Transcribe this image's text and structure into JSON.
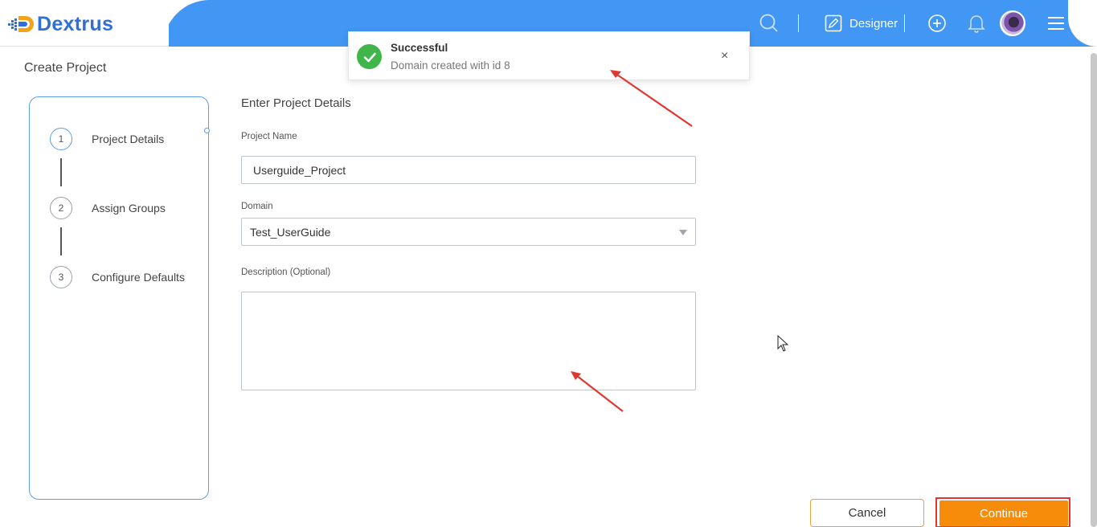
{
  "app": {
    "name": "Dextrus"
  },
  "header": {
    "role_label": "Designer",
    "icons": [
      "search-icon",
      "edit-icon",
      "add-circle-icon",
      "bell-icon",
      "menu-icon"
    ]
  },
  "page": {
    "title": "Create Project"
  },
  "steps": [
    {
      "number": "1",
      "label": "Project Details"
    },
    {
      "number": "2",
      "label": "Assign Groups"
    },
    {
      "number": "3",
      "label": "Configure Defaults"
    }
  ],
  "form": {
    "section_title": "Enter Project Details",
    "project_name_label": "Project Name",
    "project_name_value": "Userguide_Project",
    "domain_label": "Domain",
    "domain_value": "Test_UserGuide",
    "description_label": "Description (Optional)",
    "description_value": ""
  },
  "toast": {
    "title": "Successful",
    "message": "Domain created with id 8",
    "close_glyph": "×"
  },
  "buttons": {
    "cancel": "Cancel",
    "continue": "Continue"
  },
  "colors": {
    "header_blue": "#4296f4",
    "brand_blue": "#2f6fd6",
    "continue_orange": "#f78c0a",
    "cancel_border": "#e6a23c",
    "success_green": "#3fb54a",
    "annotation_red": "#e0372f"
  }
}
